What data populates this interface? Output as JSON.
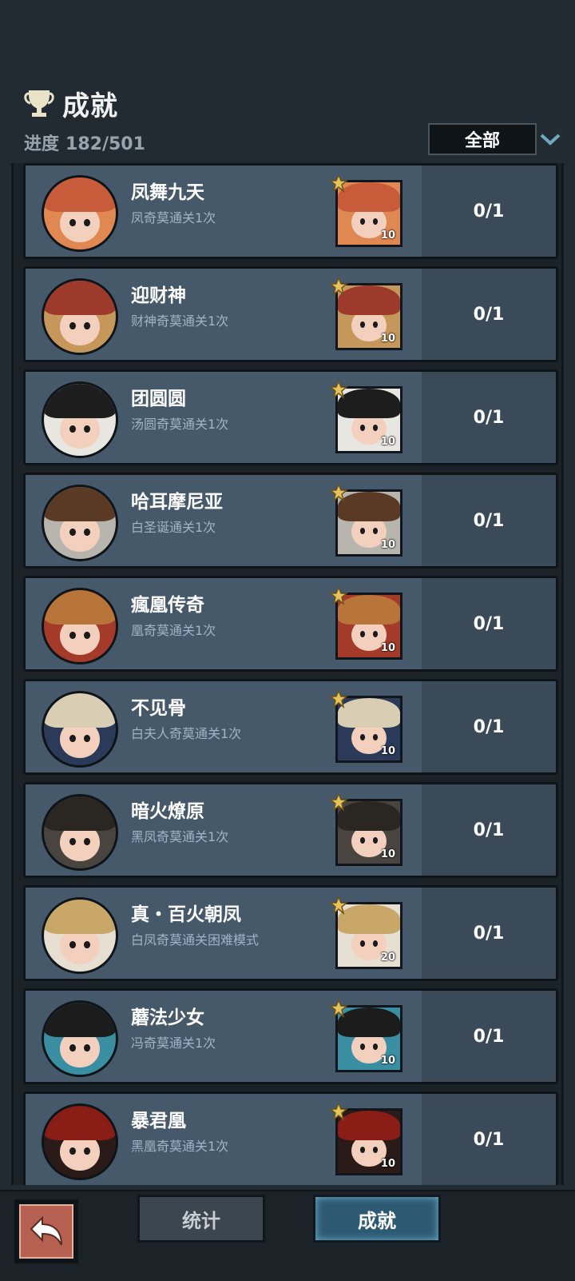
{
  "header": {
    "title": "成就",
    "progress_label": "进度",
    "progress_value": "182/501",
    "filter_value": "全部"
  },
  "achievements": [
    {
      "name": "凤舞九天",
      "desc": "凤奇莫通关1次",
      "reward_count": "10",
      "progress": "0/1",
      "colors": {
        "hair": "#c85b3a",
        "bg": "#e08852"
      }
    },
    {
      "name": "迎财神",
      "desc": "财神奇莫通关1次",
      "reward_count": "10",
      "progress": "0/1",
      "colors": {
        "hair": "#9d3a2c",
        "bg": "#c6975a"
      }
    },
    {
      "name": "团圆圆",
      "desc": "汤圆奇莫通关1次",
      "reward_count": "10",
      "progress": "0/1",
      "colors": {
        "hair": "#1d1d1d",
        "bg": "#e8e6e0"
      }
    },
    {
      "name": "哈耳摩尼亚",
      "desc": "白圣诞通关1次",
      "reward_count": "10",
      "progress": "0/1",
      "colors": {
        "hair": "#5a3a24",
        "bg": "#b8b4ae"
      }
    },
    {
      "name": "瘋凰传奇",
      "desc": "凰奇莫通关1次",
      "reward_count": "10",
      "progress": "0/1",
      "colors": {
        "hair": "#b9743a",
        "bg": "#a43a2a"
      }
    },
    {
      "name": "不见骨",
      "desc": "白夫人奇莫通关1次",
      "reward_count": "10",
      "progress": "0/1",
      "colors": {
        "hair": "#d9cdb4",
        "bg": "#2a3a58"
      }
    },
    {
      "name": "暗火燎原",
      "desc": "黑凤奇莫通关1次",
      "reward_count": "10",
      "progress": "0/1",
      "colors": {
        "hair": "#2a2622",
        "bg": "#4a4440"
      }
    },
    {
      "name": "真・百火朝凤",
      "desc": "白凤奇莫通关困难模式",
      "reward_count": "20",
      "progress": "0/1",
      "colors": {
        "hair": "#c8a768",
        "bg": "#e6dfd2"
      }
    },
    {
      "name": "蘑法少女",
      "desc": "冯奇莫通关1次",
      "reward_count": "10",
      "progress": "0/1",
      "colors": {
        "hair": "#1c1c1c",
        "bg": "#3a8ea2"
      }
    },
    {
      "name": "暴君凰",
      "desc": "黑凰奇莫通关1次",
      "reward_count": "10",
      "progress": "0/1",
      "colors": {
        "hair": "#8a1e16",
        "bg": "#2a1a18"
      }
    }
  ],
  "tabs": {
    "stats": "统计",
    "achievements": "成就"
  },
  "icons": {
    "trophy": "trophy-icon",
    "dropdown": "chevron-down-icon",
    "back": "back-arrow-icon",
    "badge": "star-badge-icon"
  }
}
